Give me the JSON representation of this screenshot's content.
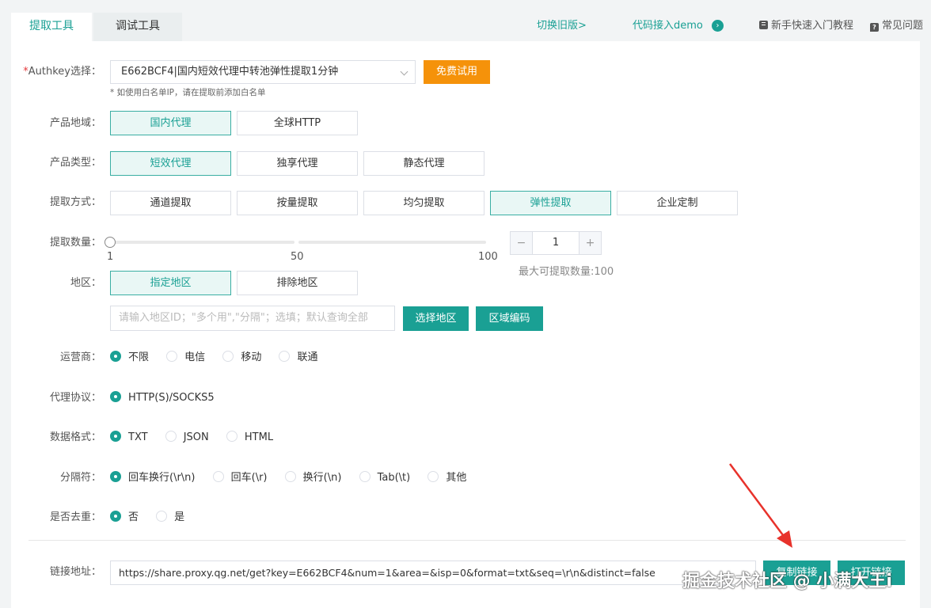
{
  "tabs": [
    {
      "label": "提取工具"
    },
    {
      "label": "调试工具"
    }
  ],
  "toplinks": {
    "switch_old": "切换旧版>",
    "code_demo": "代码接入demo",
    "tutorial": "新手快速入门教程",
    "faq": "常见问题"
  },
  "authkey": {
    "label": "Authkey选择：",
    "required_mark": "*",
    "value": "E662BCF4|国内短效代理中转池弹性提取1分钟",
    "trial_button": "免费试用",
    "hint": "* 如使用白名单IP，请在提取前添加白名单"
  },
  "region": {
    "label": "产品地域：",
    "options": [
      "国内代理",
      "全球HTTP"
    ],
    "selected": "国内代理"
  },
  "product_type": {
    "label": "产品类型：",
    "options": [
      "短效代理",
      "独享代理",
      "静态代理"
    ],
    "selected": "短效代理"
  },
  "extract_mode": {
    "label": "提取方式：",
    "options": [
      "通道提取",
      "按量提取",
      "均匀提取",
      "弹性提取",
      "企业定制"
    ],
    "selected": "弹性提取"
  },
  "quantity": {
    "label": "提取数量：",
    "ticks": [
      "1",
      "50",
      "100"
    ],
    "value": "1",
    "min": 1,
    "max": 100,
    "minus": "−",
    "plus": "+",
    "max_note": "最大可提取数量:100"
  },
  "area": {
    "label": "地区：",
    "options": [
      "指定地区",
      "排除地区"
    ],
    "selected": "指定地区",
    "input_placeholder": "请输入地区ID；\"多个用\",\"分隔\"；选填；默认查询全部",
    "select_area_button": "选择地区",
    "area_code_button": "区域编码"
  },
  "isp": {
    "label": "运营商：",
    "options": [
      "不限",
      "电信",
      "移动",
      "联通"
    ],
    "selected": "不限"
  },
  "protocol": {
    "label": "代理协议：",
    "options": [
      "HTTP(S)/SOCKS5"
    ],
    "selected": "HTTP(S)/SOCKS5"
  },
  "format": {
    "label": "数据格式：",
    "options": [
      "TXT",
      "JSON",
      "HTML"
    ],
    "selected": "TXT"
  },
  "separator": {
    "label": "分隔符：",
    "options": [
      "回车换行(\\r\\n)",
      "回车(\\r)",
      "换行(\\n)",
      "Tab(\\t)",
      "其他"
    ],
    "selected": "回车换行(\\r\\n)"
  },
  "dedupe": {
    "label": "是否去重：",
    "options": [
      "否",
      "是"
    ],
    "selected": "否"
  },
  "link": {
    "label": "链接地址：",
    "url": "https://share.proxy.qg.net/get?key=E662BCF4&num=1&area=&isp=0&format=txt&seq=\\r\\n&distinct=false",
    "copy_button": "复制链接",
    "open_button": "打开链接"
  },
  "watermark": "掘金技术社区 @ 小满大王i",
  "colors": {
    "accent": "#1aa094",
    "orange": "#f5920a",
    "arrow": "#e8322b"
  }
}
